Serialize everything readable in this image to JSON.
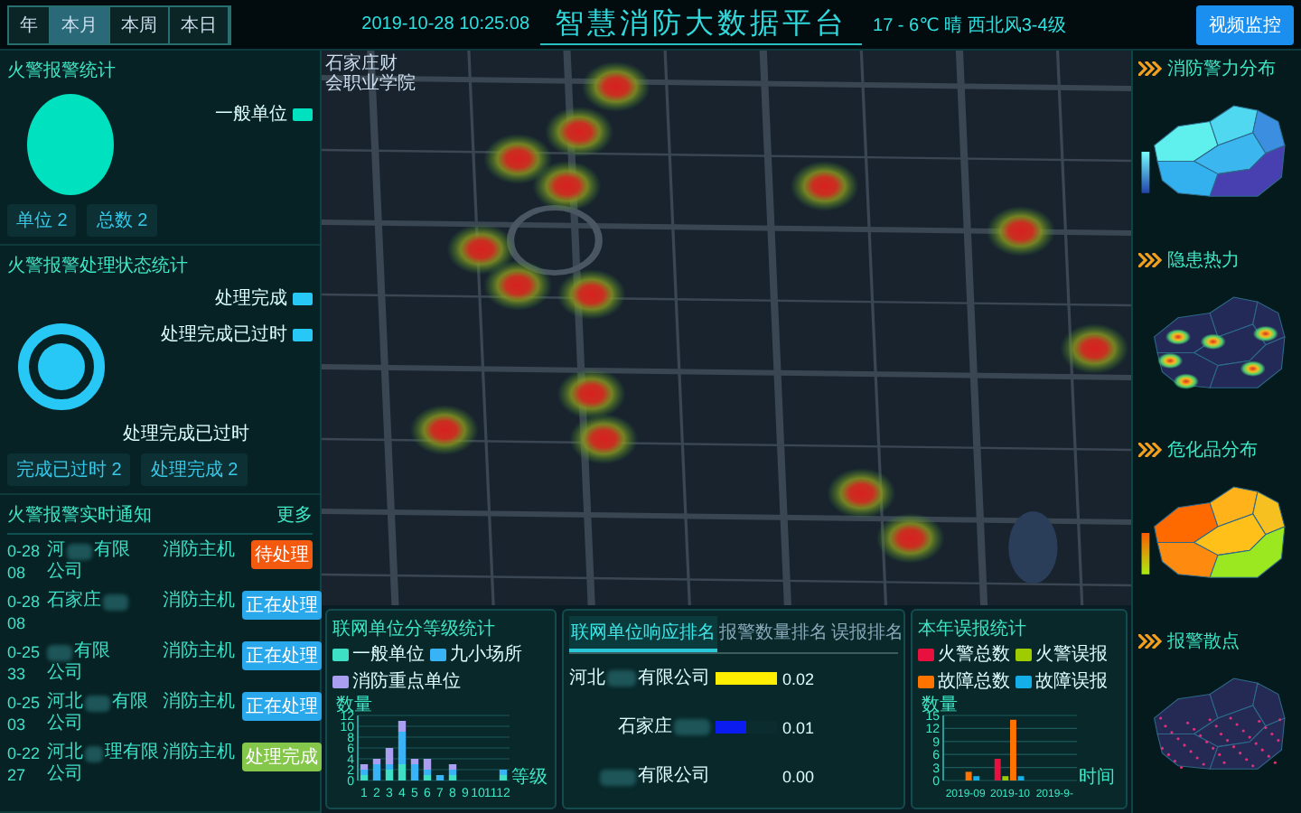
{
  "top_bar": {
    "tabs": [
      {
        "label": "年",
        "selected": false
      },
      {
        "label": "本月",
        "selected": true
      },
      {
        "label": "本周",
        "selected": false
      },
      {
        "label": "本日",
        "selected": false
      }
    ],
    "datetime": "2019-10-28 10:25:08",
    "title": "智慧消防大数据平台",
    "weather": "17 - 6℃ 晴 西北风3-4级",
    "button": "视频监控"
  },
  "map": {
    "label_lines": [
      "石家庄财",
      "会职业学院"
    ]
  },
  "fire_alarm_stats": {
    "title": "火警报警统计",
    "legend": [
      {
        "label": "一般单位",
        "color": "#00e1c0"
      }
    ],
    "stats": [
      {
        "label": "单位",
        "value": "2"
      },
      {
        "label": "总数",
        "value": "2"
      }
    ]
  },
  "alarm_status_stats": {
    "title": "火警报警处理状态统计",
    "legend": [
      {
        "label": "处理完成",
        "color": "#27c8f5"
      },
      {
        "label": "处理完成已过时",
        "color": "#27c8f5"
      }
    ],
    "callout": "处理完成已过时",
    "stats": [
      {
        "label": "完成已过时",
        "value": "2"
      },
      {
        "label": "处理完成",
        "value": "2"
      }
    ]
  },
  "notifications": {
    "title": "火警报警实时通知",
    "more": "更多",
    "rows": [
      {
        "date": "0-28",
        "time": "08",
        "name_start": "河",
        "name_end": "有限",
        "name_line2": "公司",
        "device": "消防主机",
        "status": {
          "label": "待处理",
          "kind": "pending"
        }
      },
      {
        "date": "0-28",
        "time": "08",
        "name_start": "石家庄",
        "device": "消防主机",
        "status": {
          "label": "正在处理",
          "kind": "processing"
        }
      },
      {
        "date": "0-25",
        "time": "33",
        "name_end": "有限",
        "name_line2": "公司",
        "device": "消防主机",
        "status": {
          "label": "正在处理",
          "kind": "processing"
        }
      },
      {
        "date": "0-25",
        "time": "03",
        "name_start": "河北",
        "name_end": "有限",
        "name_line2": "公司",
        "device": "消防主机",
        "status": {
          "label": "正在处理",
          "kind": "processing"
        }
      },
      {
        "date": "0-22",
        "time": "27",
        "name_start": "河北",
        "name_end": "理有限",
        "name_line2": "公司",
        "device": "消防主机",
        "status": {
          "label": "处理完成",
          "kind": "done"
        }
      }
    ]
  },
  "unit_level_chart": {
    "title": "联网单位分等级统计",
    "chart_data": {
      "type": "bar",
      "stacked": true,
      "xlabel": "等级",
      "ylabel": "数量",
      "categories": [
        "1",
        "2",
        "3",
        "4",
        "5",
        "6",
        "7",
        "8",
        "9",
        "10",
        "11",
        "12"
      ],
      "yticks": [
        0,
        2,
        4,
        6,
        8,
        10,
        12
      ],
      "ylim": [
        0,
        12
      ],
      "grid": true,
      "series": [
        {
          "name": "一般单位",
          "color": "#3de0c4",
          "values": [
            1,
            0,
            2,
            3,
            0,
            1,
            0,
            1,
            0,
            0,
            0,
            1
          ]
        },
        {
          "name": "九小场所",
          "color": "#38b4f6",
          "values": [
            1,
            3,
            1,
            6,
            3,
            1,
            1,
            1,
            0,
            0,
            0,
            1
          ]
        },
        {
          "name": "消防重点单位",
          "color": "#a99ef0",
          "values": [
            1,
            1,
            3,
            2,
            1,
            2,
            0,
            1,
            0,
            0,
            0,
            0
          ]
        }
      ]
    }
  },
  "ranking": {
    "tabs": [
      {
        "label": "联网单位响应排名",
        "selected": true
      },
      {
        "label": "报警数量排名",
        "selected": false
      },
      {
        "label": "误报排名",
        "selected": false
      }
    ],
    "rows": [
      {
        "name_start": "河北",
        "name_end": "有限公司",
        "value": "0.02",
        "level": 1,
        "color": "#ffee00"
      },
      {
        "name_start": "石家庄",
        "value": "0.01",
        "level": 0.5,
        "color": "#0a1cf0"
      },
      {
        "name_end": "有限公司",
        "value": "0.00"
      }
    ]
  },
  "false_alarm_chart": {
    "title": "本年误报统计",
    "chart_data": {
      "type": "bar",
      "stacked": false,
      "xlabel": "时间",
      "ylabel": "数量",
      "categories": [
        "2019-09",
        "2019-10",
        "2019-9-"
      ],
      "yticks": [
        0,
        3,
        6,
        9,
        12,
        15
      ],
      "ylim": [
        0,
        15
      ],
      "grid": true,
      "series": [
        {
          "name": "火警总数",
          "color": "#e8103f",
          "values": [
            0,
            5,
            0
          ]
        },
        {
          "name": "火警误报",
          "color": "#9fcc00",
          "values": [
            0,
            1,
            0
          ]
        },
        {
          "name": "故障总数",
          "color": "#ff7300",
          "values": [
            2,
            14,
            0
          ]
        },
        {
          "name": "故障误报",
          "color": "#14aee8",
          "values": [
            1,
            1,
            0
          ]
        }
      ]
    }
  },
  "right_maps": [
    {
      "title": "消防警力分布",
      "kind": "power"
    },
    {
      "title": "隐患热力",
      "kind": "heat"
    },
    {
      "title": "危化品分布",
      "kind": "hazard"
    },
    {
      "title": "报警散点",
      "kind": "scatter"
    }
  ]
}
